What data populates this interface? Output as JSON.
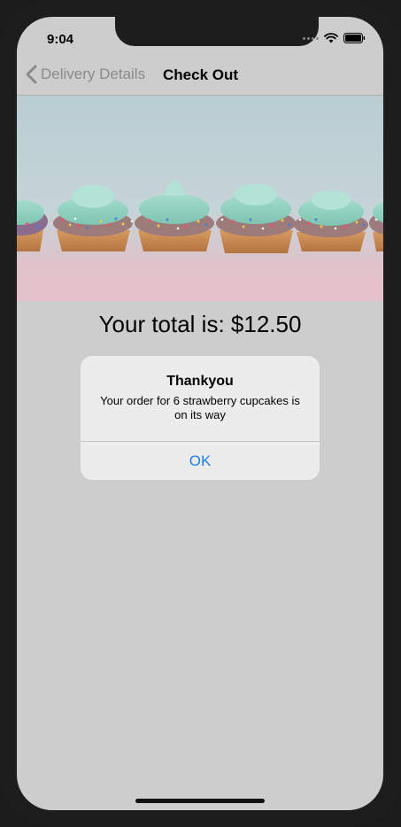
{
  "status_bar": {
    "time": "9:04"
  },
  "navigation": {
    "back_label": "Delivery Details",
    "title": "Check Out"
  },
  "order": {
    "total_text": "Your total is: $12.50"
  },
  "alert": {
    "title": "Thankyou",
    "message": "Your order for 6 strawberry cupcakes is on its way",
    "ok_label": "OK"
  },
  "colors": {
    "screen_background": "#cdcdcd",
    "accent": "#1f7fe0",
    "frosting": "#8fd1bf",
    "cupcake_liner": "#c98a4f"
  },
  "icons": [
    "back-chevron-icon",
    "cellular-signal-icon",
    "wifi-icon",
    "battery-icon"
  ]
}
